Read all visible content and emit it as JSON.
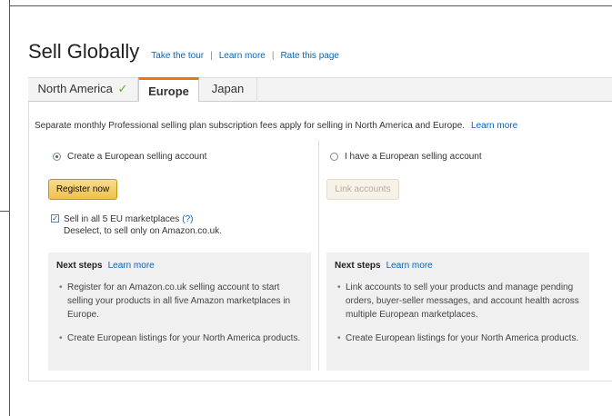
{
  "header": {
    "title": "Sell Globally",
    "links": [
      "Take the tour",
      "Learn more",
      "Rate this page"
    ],
    "separator": "|"
  },
  "tabs": [
    {
      "label": "North America",
      "check": "✓",
      "selected": false
    },
    {
      "label": "Europe",
      "selected": true
    },
    {
      "label": "Japan",
      "selected": false
    }
  ],
  "notice": {
    "text": "Separate monthly Professional selling plan subscription fees apply for selling in North America and Europe.",
    "link": "Learn more"
  },
  "left": {
    "radio_label": "Create a European selling account",
    "button": "Register now",
    "checkbox_label": "Sell in all 5 EU marketplaces",
    "checkbox_help": "(?)",
    "checkbox_note": "Deselect, to sell only on Amazon.co.uk.",
    "steps": {
      "heading": "Next steps",
      "link": "Learn more",
      "items": [
        "Register for an Amazon.co.uk selling account to start selling your products in all five Amazon marketplaces in Europe.",
        "Create European listings for your North America products."
      ]
    }
  },
  "right": {
    "radio_label": "I have a European selling account",
    "button": "Link accounts",
    "steps": {
      "heading": "Next steps",
      "link": "Learn more",
      "items": [
        "Link accounts to sell your products and manage pending orders, buyer-seller messages, and account health across multiple European marketplaces.",
        "Create European listings for your North America products."
      ]
    }
  },
  "colors": {
    "accent_tab": "#e47911",
    "link": "#0066c0",
    "check": "#5fae26",
    "primary_button": "#f0c14b"
  }
}
